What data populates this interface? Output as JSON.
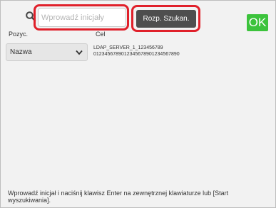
{
  "search": {
    "placeholder": "Wprowadź inicjały",
    "button_label": "Rozp. Szukan."
  },
  "ok_label": "OK",
  "columns": {
    "position": "Pozyc.",
    "target": "Cel"
  },
  "sort_select": {
    "selected": "Nazwa"
  },
  "server": {
    "name": "LDAP_SERVER_1_123456789",
    "number": "0123456789012345678901234567890"
  },
  "footer": {
    "hint": "Wprowadź inicjał i naciśnij klawisz Enter na zewnętrznej klawiaturze lub [Start wyszukiwania]."
  },
  "colors": {
    "highlight": "#e0202a",
    "ok": "#3cc33c",
    "button": "#4e4e4e"
  }
}
